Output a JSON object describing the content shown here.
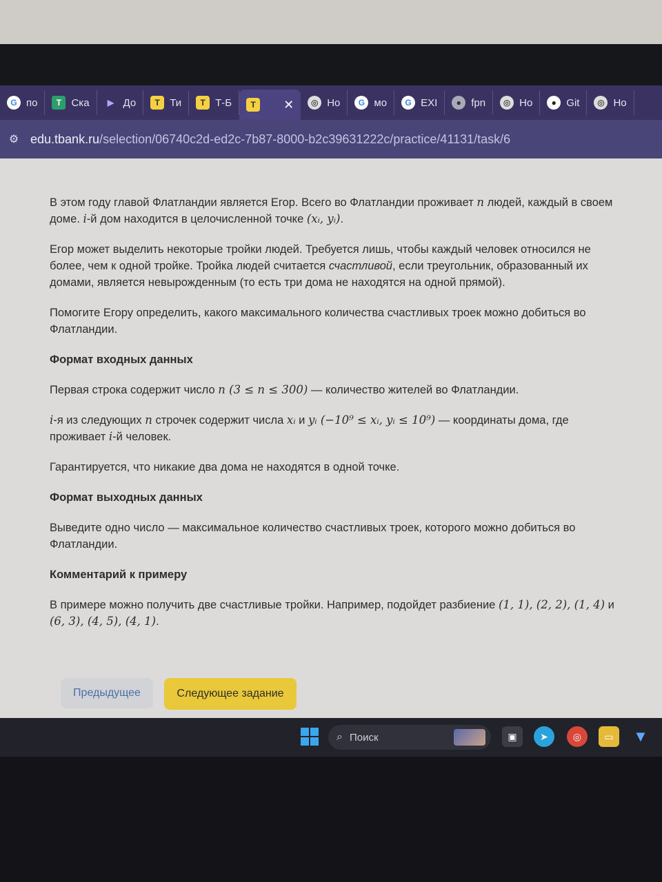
{
  "tabs": [
    {
      "label": "по",
      "icon": "google-icon"
    },
    {
      "label": "Ска",
      "icon": "tilda-icon"
    },
    {
      "label": "До",
      "icon": "play-icon"
    },
    {
      "label": "Ти",
      "icon": "tbank-icon"
    },
    {
      "label": "Т-Б",
      "icon": "tbank-icon"
    },
    {
      "label": "",
      "icon": "tbank-icon",
      "active": true
    },
    {
      "label": "Но",
      "icon": "chrome-icon"
    },
    {
      "label": "мо",
      "icon": "google-icon"
    },
    {
      "label": "EXI",
      "icon": "google-icon"
    },
    {
      "label": "fpn",
      "icon": "globe-icon"
    },
    {
      "label": "Но",
      "icon": "chrome-icon"
    },
    {
      "label": "Git",
      "icon": "github-icon"
    },
    {
      "label": "Но",
      "icon": "chrome-icon"
    }
  ],
  "address": {
    "domain": "edu.tbank.ru",
    "path": "/selection/06740c2d-ed2c-7b87-8000-b2c39631222c/practice/41131/task/6"
  },
  "task": {
    "p1_a": "В этом году главой Флатландии является Егор. Всего во Флатландии проживает ",
    "p1_n": "n",
    "p1_b": " людей, каждый в своем доме. ",
    "p1_i": "i",
    "p1_c": "-й дом находится в целочисленной точке ",
    "p1_point": "(xᵢ, yᵢ)",
    "p1_d": ".",
    "p2_a": "Егор может выделить некоторые тройки людей. Требуется лишь, чтобы каждый человек относился не более, чем к одной тройке. Тройка людей считается ",
    "p2_em": "счастливой",
    "p2_b": ", если треугольник, образованный их домами, является невырожденным (то есть три дома не находятся на одной прямой).",
    "p3": "Помогите Егору определить, какого максимального количества счастливых троек можно добиться во Флатландии.",
    "input_heading": "Формат входных данных",
    "in1_a": "Первая строка содержит число ",
    "in1_n": "n",
    "in1_range": " (3 ≤ n ≤ 300)",
    "in1_b": " — количество жителей во Флатландии.",
    "in2_i": "i",
    "in2_a": "-я из следующих ",
    "in2_n": "n",
    "in2_b": " строчек содержит числа ",
    "in2_x": "xᵢ",
    "in2_and": " и ",
    "in2_y": "yᵢ",
    "in2_range": " (−10⁹ ≤ xᵢ, yᵢ ≤ 10⁹)",
    "in2_c": " — координаты дома, где проживает ",
    "in2_i2": "i",
    "in2_d": "-й человек.",
    "in3": "Гарантируется, что никакие два дома не находятся в одной точке.",
    "output_heading": "Формат выходных данных",
    "out1": "Выведите одно число — максимальное количество счастливых троек, которого можно добиться во Флатландии.",
    "comment_heading": "Комментарий к примеру",
    "c1_a": "В примере можно получить две счастливые тройки. Например, подойдет разбиение ",
    "c1_m1": "(1, 1), (2, 2), (1, 4)",
    "c1_and": " и ",
    "c1_m2": "(6, 3), (4, 5), (4, 1)",
    "c1_b": "."
  },
  "buttons": {
    "prev": "Предыдущее",
    "next": "Следующее задание"
  },
  "taskbar": {
    "search_label": "Поиск",
    "icons": [
      "windows-start-icon",
      "search-icon",
      "task-view-icon",
      "telegram-icon",
      "chrome-icon",
      "file-explorer-icon",
      "app-icon"
    ]
  }
}
